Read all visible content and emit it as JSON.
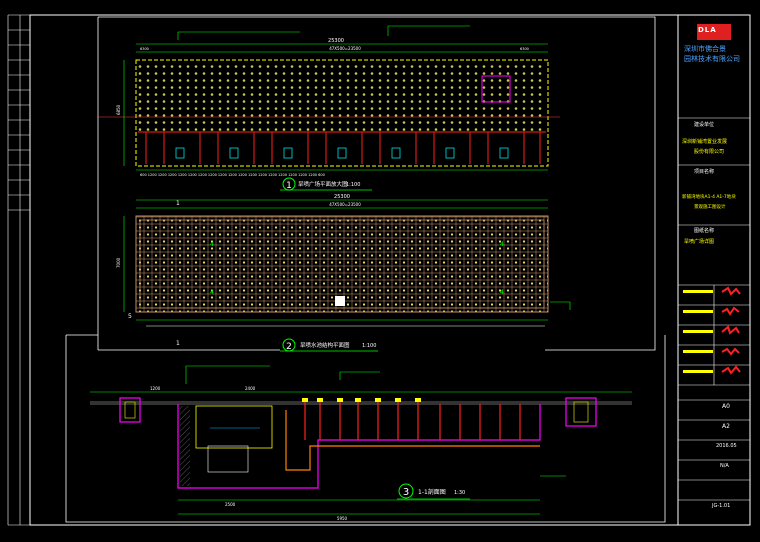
{
  "company": {
    "logo_text": "DLA",
    "name_line1": "深圳市佛合景",
    "name_line2": "园林技术有限公司"
  },
  "title_block": {
    "client_label": "建设单位",
    "client_name_line1": "深圳新铺湾置业发展",
    "client_name_line2": "股份有限公司",
    "project_label": "项目名称",
    "project_name_line1": "新铺湾地块A1-4 A1-7地块",
    "project_name_line2": "景观施工图设计",
    "drawing_label": "图纸名称",
    "drawing_name": "旱喷广场详图",
    "scale_value": "A0",
    "sheet_size": "A2",
    "date": "2016.05",
    "number": "N/A",
    "drawing_no": "JG-1.01"
  },
  "views": {
    "plan1_title": "旱喷广场平面放大图",
    "plan1_scale": "1:100",
    "plan2_title": "旱喷水池结构平面图",
    "plan2_scale": "1:100",
    "section_title": "1-1剖面图",
    "section_scale": "1:30",
    "label_1": "1",
    "label_2": "2",
    "label_3": "3"
  },
  "dims": {
    "plan1_total": "25300",
    "plan1_sub": "47X500=23500",
    "plan1_height": "6850",
    "plan2_total": "25300",
    "plan2_sub": "47X500=23500",
    "plan2_height": "7000",
    "section_total": "5950",
    "section_left": "1200",
    "section_mid": "2400",
    "section_sub": "2500"
  },
  "colors": {
    "background": "#000000",
    "frame": "#ffffff",
    "dimension": "#00ff00",
    "accent_yellow": "#ffff00",
    "accent_red": "#ff0000",
    "accent_magenta": "#ff00ff",
    "accent_cyan": "#00ffff"
  }
}
